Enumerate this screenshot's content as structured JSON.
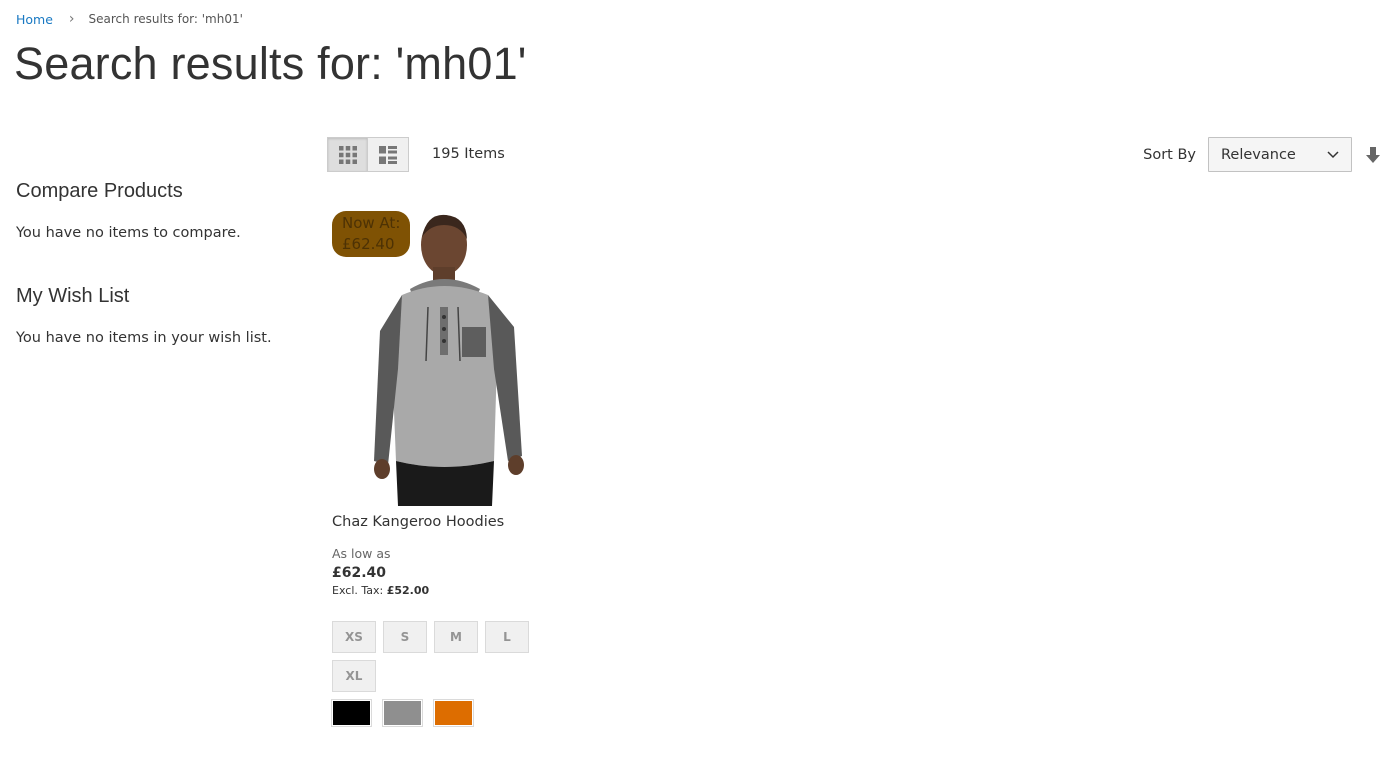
{
  "breadcrumb": {
    "home": "Home",
    "current": "Search results for: 'mh01'"
  },
  "page": {
    "title": "Search results for: 'mh01'"
  },
  "sidebar": {
    "compare_title": "Compare Products",
    "compare_text": "You have no items to compare.",
    "wishlist_title": "My Wish List",
    "wishlist_text": "You have no items in your wish list."
  },
  "toolbar": {
    "modes": [
      "grid-icon",
      "list-icon"
    ],
    "active_mode": "grid",
    "amount": "195 Items",
    "sort_label": "Sort By",
    "sort_value": "Relevance",
    "sort_direction_icon": "arrow-down-icon"
  },
  "product": {
    "badge_line1": "Now At:",
    "badge_line2": "£62.40",
    "badge_color": "#7d4f00",
    "name": "Chaz Kangeroo Hoodies",
    "price_label": "As low as",
    "price": "£62.40",
    "excl_label": "Excl. Tax:",
    "excl_value": "£52.00",
    "sizes": [
      "XS",
      "S",
      "M",
      "L",
      "XL"
    ],
    "colors": [
      "#000000",
      "#8f8f8f",
      "#dd6d00"
    ]
  }
}
